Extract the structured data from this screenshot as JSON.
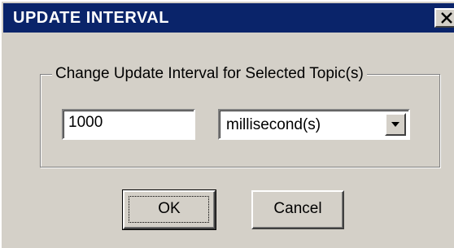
{
  "window": {
    "title": "UPDATE INTERVAL",
    "close_icon": "close-icon",
    "title_bar_color": "#0a246a",
    "face_color": "#d4d0c8"
  },
  "group": {
    "label": "Change Update Interval for Selected Topic(s)"
  },
  "interval": {
    "value": "1000"
  },
  "unit_select": {
    "selected": "millisecond(s)",
    "dropdown_icon": "chevron-down-icon"
  },
  "buttons": {
    "ok_label": "OK",
    "cancel_label": "Cancel"
  }
}
